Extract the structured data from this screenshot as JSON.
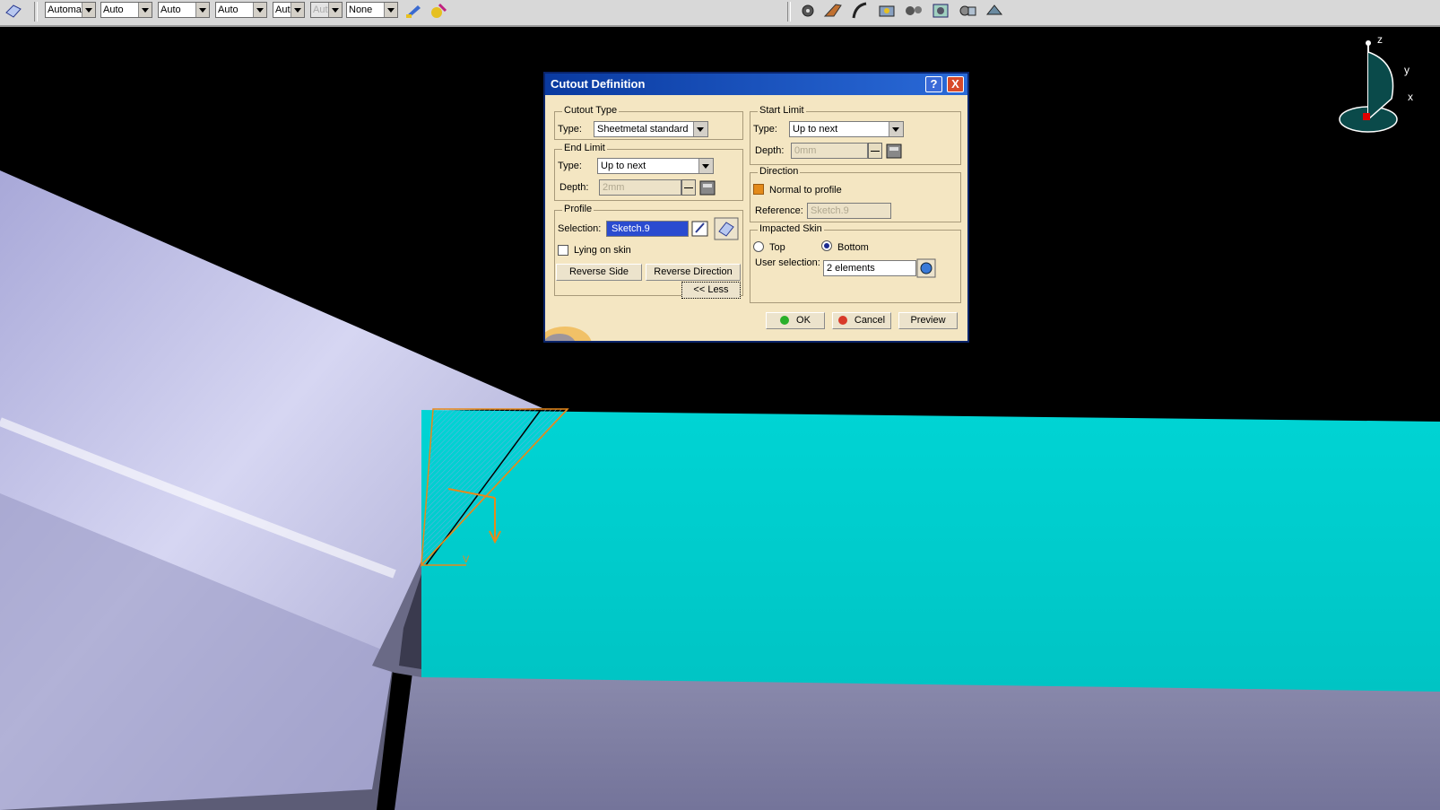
{
  "toolbar": {
    "combos": [
      {
        "value": "Automa",
        "disabled": false
      },
      {
        "value": "Auto",
        "disabled": false
      },
      {
        "value": "Auto",
        "disabled": false
      },
      {
        "value": "Auto",
        "disabled": false
      },
      {
        "value": "Aut",
        "disabled": false
      },
      {
        "value": "Aut",
        "disabled": true
      },
      {
        "value": "None",
        "disabled": false
      }
    ]
  },
  "dialog": {
    "title": "Cutout Definition",
    "help_label": "?",
    "close_label": "X",
    "cutout_type": {
      "group_label": "Cutout Type",
      "type_label": "Type:",
      "type_value": "Sheetmetal standard"
    },
    "end_limit": {
      "group_label": "End Limit",
      "type_label": "Type:",
      "type_value": "Up to next",
      "depth_label": "Depth:",
      "depth_value": "2mm"
    },
    "profile": {
      "group_label": "Profile",
      "selection_label": "Selection:",
      "selection_value": "Sketch.9",
      "lying_on_skin_label": "Lying on skin",
      "lying_on_skin_checked": false,
      "reverse_side_label": "Reverse Side",
      "reverse_direction_label": "Reverse Direction",
      "less_label": "<< Less"
    },
    "start_limit": {
      "group_label": "Start Limit",
      "type_label": "Type:",
      "type_value": "Up to next",
      "depth_label": "Depth:",
      "depth_value": "0mm"
    },
    "direction": {
      "group_label": "Direction",
      "normal_label": "Normal to profile",
      "normal_checked": true,
      "reference_label": "Reference:",
      "reference_value": "Sketch.9"
    },
    "impacted_skin": {
      "group_label": "Impacted Skin",
      "top_label": "Top",
      "bottom_label": "Bottom",
      "selected": "Bottom",
      "user_selection_label": "User selection:",
      "user_selection_value": "2 elements"
    },
    "ok_label": "OK",
    "cancel_label": "Cancel",
    "preview_label": "Preview"
  },
  "compass": {
    "z_label": "z",
    "y_label": "y",
    "x_label": "x"
  },
  "sketch_axis_label": "V",
  "colors": {
    "accent_dialog": "#f4e6c2",
    "titlebar": "#0a3aa0",
    "part_face": "#00cccc",
    "surface": "#b8b8e0",
    "profile": "#e8891a"
  }
}
